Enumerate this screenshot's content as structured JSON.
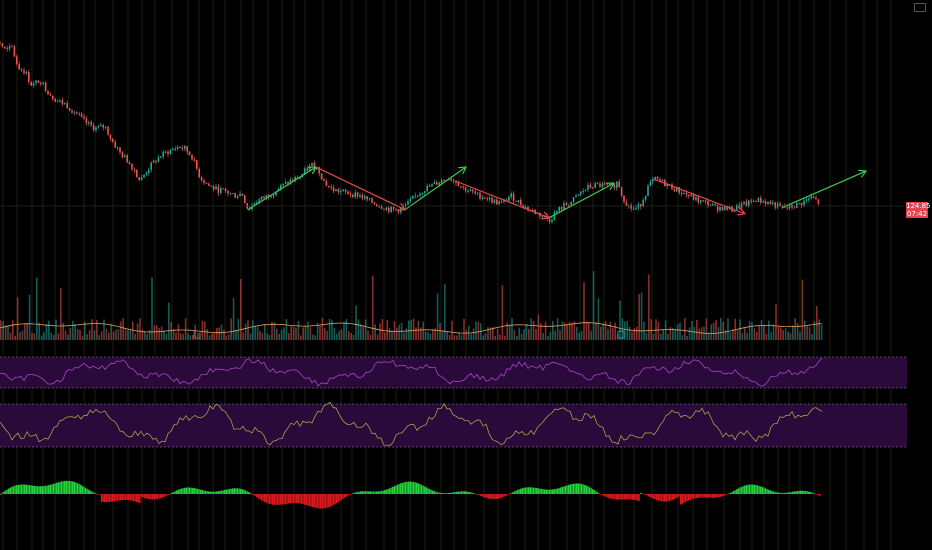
{
  "price_tag": {
    "value": "124.85",
    "timer": "07:42",
    "color": "#e0474f"
  },
  "colors": {
    "background": "#000000",
    "candle_up": "#26a69a",
    "candle_down": "#ef5350",
    "arrow_up": "#3fc94a",
    "arrow_down": "#e8474c",
    "volume_ma": "#e8a060",
    "rsi_line": "#a845c8",
    "osc_line": "#b9b24a",
    "band_fill": "#2a0a3a",
    "hist_pos": "#22d33a",
    "hist_neg": "#e0191f",
    "session_lines": "#35391c"
  },
  "chart_data": {
    "type": "line",
    "title": "",
    "price_path": [
      [
        0,
        152
      ],
      [
        6,
        148
      ],
      [
        12,
        150
      ],
      [
        18,
        140
      ],
      [
        25,
        138
      ],
      [
        32,
        131
      ],
      [
        40,
        134
      ],
      [
        48,
        128
      ],
      [
        56,
        124
      ],
      [
        65,
        122
      ],
      [
        75,
        118
      ],
      [
        85,
        113
      ],
      [
        95,
        110
      ],
      [
        105,
        111
      ],
      [
        112,
        104
      ],
      [
        120,
        98
      ],
      [
        128,
        94
      ],
      [
        134,
        90
      ],
      [
        140,
        84
      ],
      [
        148,
        90
      ],
      [
        155,
        94
      ],
      [
        162,
        97
      ],
      [
        170,
        99
      ],
      [
        178,
        101
      ],
      [
        185,
        100
      ],
      [
        192,
        96
      ],
      [
        200,
        86
      ],
      [
        208,
        82
      ],
      [
        216,
        80
      ],
      [
        225,
        79
      ],
      [
        235,
        77
      ],
      [
        242,
        78
      ],
      [
        248,
        70
      ],
      [
        256,
        74
      ],
      [
        264,
        76
      ],
      [
        272,
        78
      ],
      [
        280,
        81
      ],
      [
        290,
        84
      ],
      [
        300,
        86
      ],
      [
        305,
        89
      ],
      [
        312,
        92
      ],
      [
        318,
        90
      ],
      [
        325,
        83
      ],
      [
        332,
        80
      ],
      [
        340,
        79
      ],
      [
        350,
        78
      ],
      [
        360,
        77
      ],
      [
        370,
        74
      ],
      [
        380,
        72
      ],
      [
        390,
        70
      ],
      [
        400,
        70
      ],
      [
        408,
        73
      ],
      [
        416,
        77
      ],
      [
        424,
        80
      ],
      [
        432,
        82
      ],
      [
        440,
        84
      ],
      [
        448,
        86
      ],
      [
        456,
        84
      ],
      [
        462,
        81
      ],
      [
        470,
        79
      ],
      [
        478,
        77
      ],
      [
        486,
        76
      ],
      [
        494,
        74
      ],
      [
        502,
        73
      ],
      [
        510,
        77
      ],
      [
        518,
        74
      ],
      [
        526,
        71
      ],
      [
        534,
        69
      ],
      [
        542,
        67
      ],
      [
        550,
        65
      ],
      [
        556,
        69
      ],
      [
        564,
        72
      ],
      [
        572,
        74
      ],
      [
        580,
        78
      ],
      [
        588,
        81
      ],
      [
        596,
        82
      ],
      [
        604,
        82
      ],
      [
        612,
        81
      ],
      [
        618,
        84
      ],
      [
        622,
        77
      ],
      [
        628,
        72
      ],
      [
        634,
        70
      ],
      [
        640,
        72
      ],
      [
        648,
        81
      ],
      [
        654,
        85
      ],
      [
        660,
        84
      ],
      [
        668,
        82
      ],
      [
        676,
        80
      ],
      [
        684,
        78
      ],
      [
        692,
        76
      ],
      [
        700,
        74
      ],
      [
        708,
        73
      ],
      [
        716,
        71
      ],
      [
        724,
        71
      ],
      [
        732,
        70
      ],
      [
        740,
        72
      ],
      [
        748,
        73
      ],
      [
        756,
        75
      ],
      [
        764,
        74
      ],
      [
        772,
        73
      ],
      [
        780,
        71
      ],
      [
        788,
        71
      ],
      [
        796,
        72
      ],
      [
        804,
        74
      ],
      [
        812,
        76
      ],
      [
        820,
        73
      ]
    ],
    "trend_arrows": [
      {
        "direction": "up",
        "from": [
          248,
          70
        ],
        "to": [
          316,
          91
        ]
      },
      {
        "direction": "down",
        "from": [
          316,
          91
        ],
        "to": [
          405,
          70
        ]
      },
      {
        "direction": "up",
        "from": [
          405,
          70
        ],
        "to": [
          466,
          91
        ]
      },
      {
        "direction": "down",
        "from": [
          456,
          84
        ],
        "to": [
          549,
          66
        ]
      },
      {
        "direction": "up",
        "from": [
          549,
          66
        ],
        "to": [
          614,
          83
        ]
      },
      {
        "direction": "down",
        "from": [
          654,
          85
        ],
        "to": [
          745,
          68
        ]
      },
      {
        "direction": "up",
        "from": [
          782,
          71
        ],
        "to": [
          866,
          89
        ]
      }
    ],
    "ylim": [
      60,
      156
    ],
    "xlim": [
      0,
      932
    ],
    "current_price": 124.85
  }
}
